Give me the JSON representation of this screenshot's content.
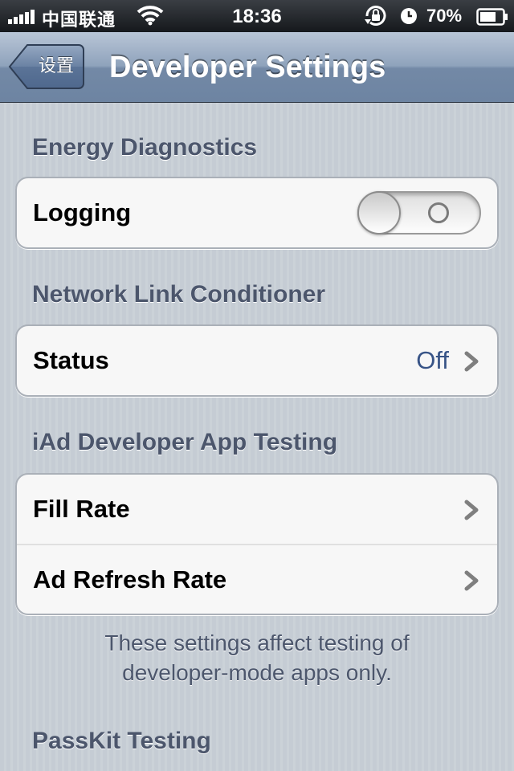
{
  "status_bar": {
    "carrier": "中国联通",
    "time": "18:36",
    "battery_percent": "70%",
    "signal_icon": "signal-bars-icon",
    "wifi_icon": "wifi-icon",
    "rotation_lock_icon": "rotation-lock-icon",
    "alarm_icon": "alarm-clock-icon",
    "battery_icon": "battery-icon",
    "battery_level": 0.7
  },
  "nav": {
    "back_label": "设置",
    "title": "Developer Settings"
  },
  "sections": {
    "energy": {
      "header": "Energy Diagnostics",
      "logging_label": "Logging",
      "logging_on": false
    },
    "network": {
      "header": "Network Link Conditioner",
      "status_label": "Status",
      "status_value": "Off"
    },
    "iad": {
      "header": "iAd Developer App Testing",
      "fill_rate_label": "Fill Rate",
      "ad_refresh_label": "Ad Refresh Rate",
      "footer_line1": "These settings affect testing of",
      "footer_line2": "developer-mode apps only."
    },
    "passkit": {
      "header": "PassKit Testing"
    }
  },
  "colors": {
    "nav_bar": "#7d92ad",
    "section_header": "#4c566c",
    "detail_value": "#385487",
    "background": "#cbd2d8"
  }
}
